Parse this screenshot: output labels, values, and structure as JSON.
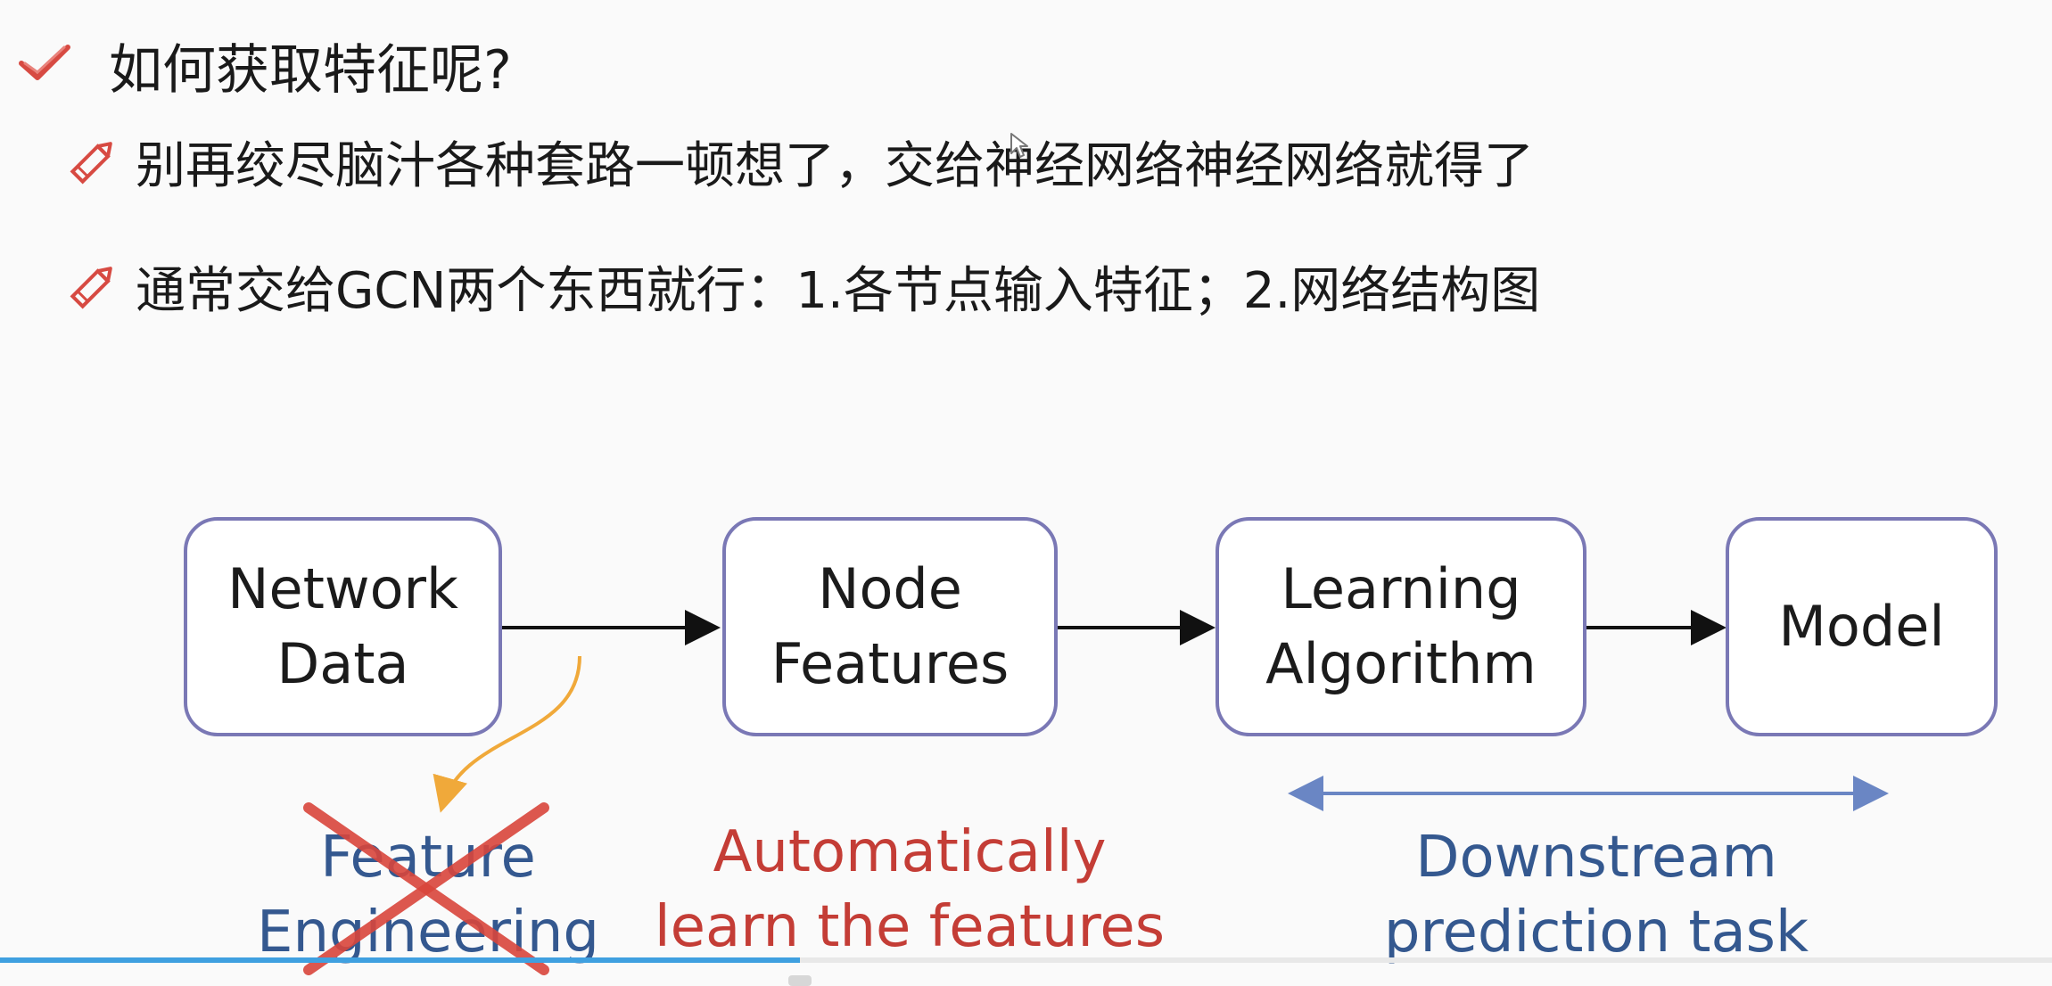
{
  "heading": {
    "text": "如何获取特征呢?"
  },
  "bullets": [
    {
      "text": "别再绞尽脑汁各种套路一顿想了，交给神经网络神经网络就得了"
    },
    {
      "text": "通常交给GCN两个东西就行：1.各节点输入特征；2.网络结构图"
    }
  ],
  "diagram": {
    "nodes": [
      {
        "label": "Network\nData"
      },
      {
        "label": "Node\nFeatures"
      },
      {
        "label": "Learning\nAlgorithm"
      },
      {
        "label": "Model"
      }
    ],
    "captions": {
      "feature_engineering": "Feature\nEngineering",
      "automatic": "Automatically\nlearn the features",
      "downstream": "Downstream\nprediction task"
    }
  },
  "colors": {
    "node_border": "#7a78b5",
    "accent_red": "#c43d36",
    "accent_blue": "#34588f",
    "orange_arrow": "#f0a93a",
    "cross_red": "#d9463c",
    "progress": "#3fa0e0"
  },
  "video": {
    "progress_fraction": 0.39
  }
}
